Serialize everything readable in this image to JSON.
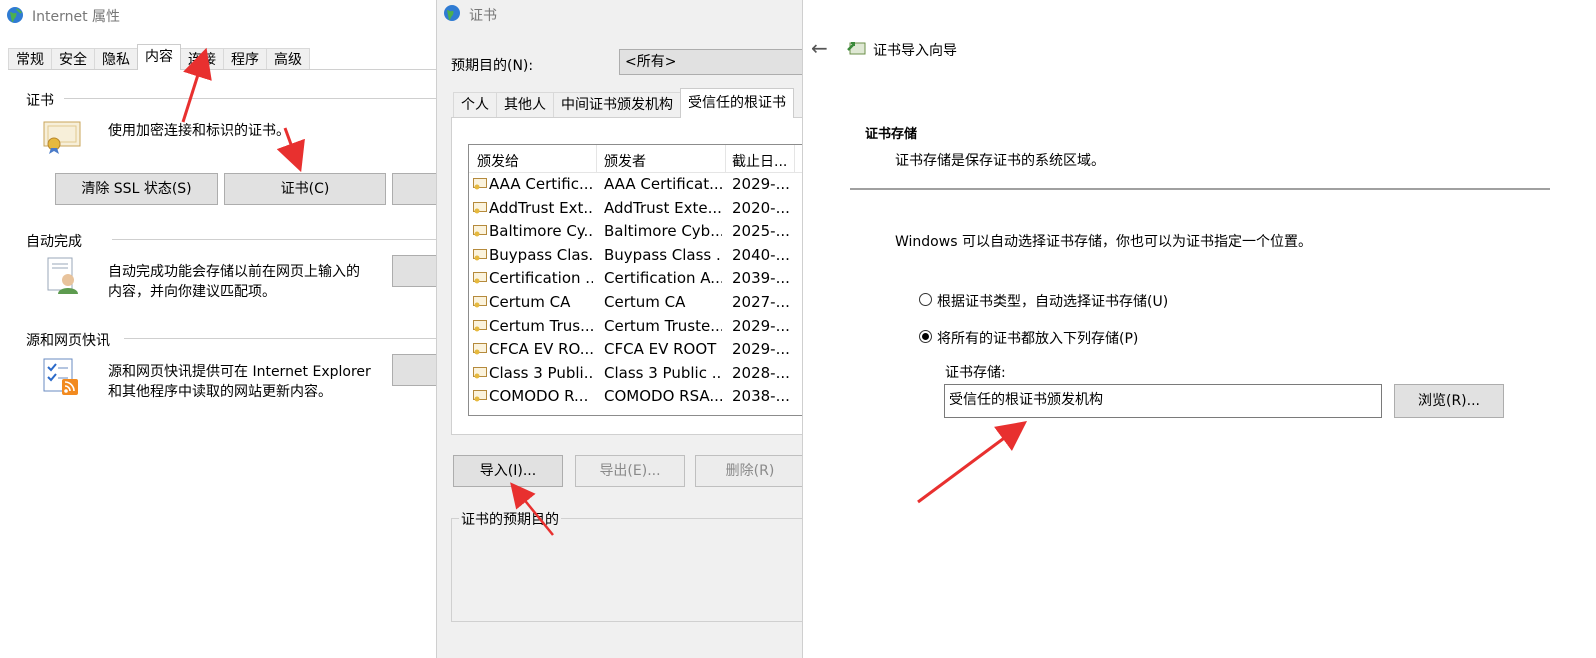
{
  "window1": {
    "title": "Internet 属性",
    "tabs": [
      "常规",
      "安全",
      "隐私",
      "内容",
      "连接",
      "程序",
      "高级"
    ],
    "cert_section": {
      "title": "证书",
      "desc": "使用加密连接和标识的证书。",
      "clear_ssl": "清除 SSL 状态(S)",
      "certificates": "证书(C)"
    },
    "autocomplete": {
      "title": "自动完成",
      "desc_line1": "自动完成功能会存储以前在网页上输入的",
      "desc_line2": "内容，并向你建议匹配项。"
    },
    "feeds": {
      "title": "源和网页快讯",
      "desc_line1": "源和网页快讯提供可在 Internet Explorer",
      "desc_line2": "和其他程序中读取的网站更新内容。"
    }
  },
  "window2": {
    "title": "证书",
    "purpose_label": "预期目的(N):",
    "purpose_value": "<所有>",
    "tabs": [
      "个人",
      "其他人",
      "中间证书颁发机构",
      "受信任的根证书"
    ],
    "columns": [
      "颁发给",
      "颁发者",
      "截止日...",
      ""
    ],
    "rows": [
      {
        "issued_to": "AAA Certific...",
        "issuer": "AAA Certificat...",
        "expires": "2029-..."
      },
      {
        "issued_to": "AddTrust Ext...",
        "issuer": "AddTrust Exte...",
        "expires": "2020-..."
      },
      {
        "issued_to": "Baltimore Cy...",
        "issuer": "Baltimore Cyb...",
        "expires": "2025-..."
      },
      {
        "issued_to": "Buypass Clas...",
        "issuer": "Buypass Class ...",
        "expires": "2040-..."
      },
      {
        "issued_to": "Certification ...",
        "issuer": "Certification A...",
        "expires": "2039-..."
      },
      {
        "issued_to": "Certum CA",
        "issuer": "Certum CA",
        "expires": "2027-..."
      },
      {
        "issued_to": "Certum Trus...",
        "issuer": "Certum Truste...",
        "expires": "2029-..."
      },
      {
        "issued_to": "CFCA EV RO...",
        "issuer": "CFCA EV ROOT",
        "expires": "2029-..."
      },
      {
        "issued_to": "Class 3 Publi...",
        "issuer": "Class 3 Public ...",
        "expires": "2028-..."
      },
      {
        "issued_to": "COMODO R...",
        "issuer": "COMODO RSA...",
        "expires": "2038-..."
      }
    ],
    "import": "导入(I)...",
    "export": "导出(E)...",
    "delete": "删除(R)",
    "purposes_group": "证书的预期目的"
  },
  "window3": {
    "back": "←",
    "title": "证书导入向导",
    "heading": "证书存储",
    "subheading": "证书存储是保存证书的系统区域。",
    "intro": "Windows 可以自动选择证书存储，你也可以为证书指定一个位置。",
    "radio_auto": "根据证书类型，自动选择证书存储(U)",
    "radio_manual": "将所有的证书都放入下列存储(P)",
    "store_label": "证书存储:",
    "store_value": "受信任的根证书颁发机构",
    "browse": "浏览(R)..."
  },
  "colors": {
    "annotation": "#e8302f",
    "button_bg": "#e1e1e1",
    "dialog_bg": "#f0f0f0"
  }
}
